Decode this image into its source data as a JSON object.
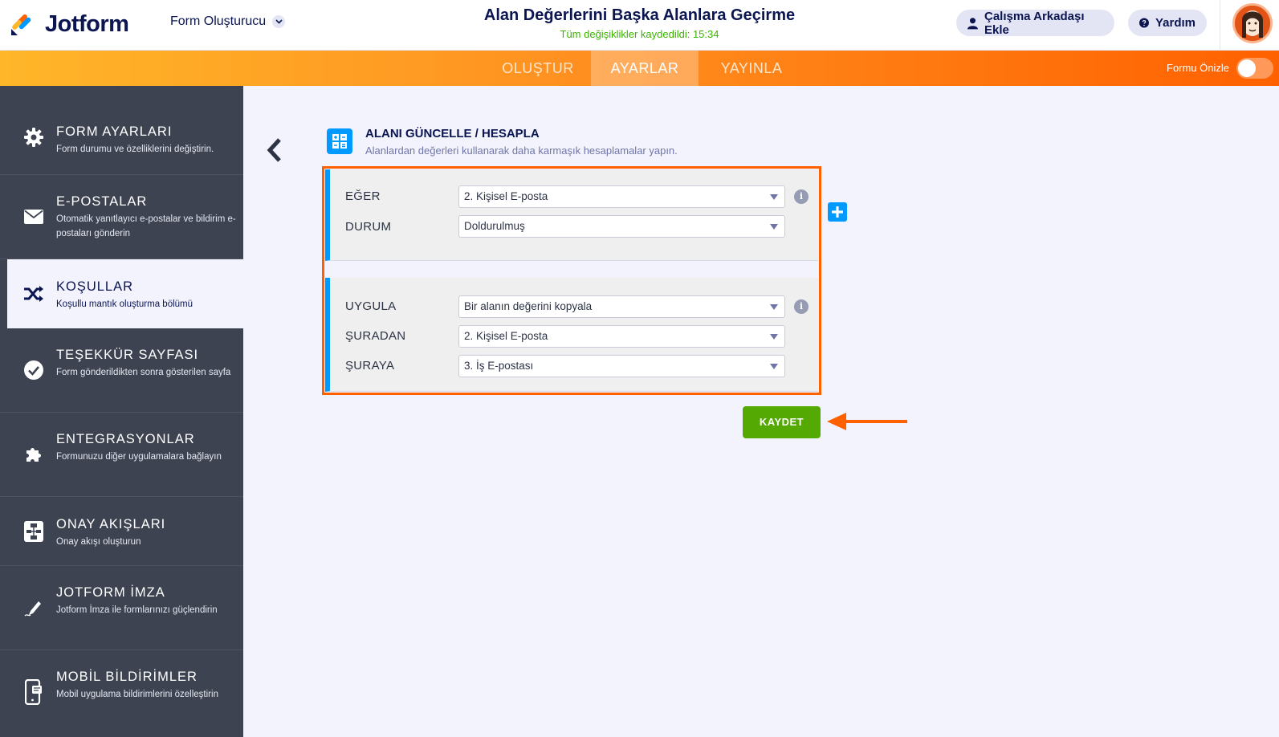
{
  "header": {
    "logo_text": "Jotform",
    "builder_select": "Form Oluşturucu",
    "title": "Alan Değerlerini Başka Alanlara Geçirme",
    "saved_status": "Tüm değişiklikler kaydedildi: 15:34",
    "invite_label": "Çalışma Arkadaşı Ekle",
    "help_label": "Yardım"
  },
  "tabs": {
    "create": "OLUŞTUR",
    "settings": "AYARLAR",
    "publish": "YAYINLA",
    "active": "AYARLAR"
  },
  "preview": {
    "label": "Formu Önizle",
    "enabled": false
  },
  "sidebar": {
    "items": [
      {
        "title": "FORM AYARLARI",
        "desc": "Form durumu ve özelliklerini değiştirin.",
        "icon": "gear-icon"
      },
      {
        "title": "E-POSTALAR",
        "desc": "Otomatik yanıtlayıcı e-postalar ve bildirim e-postaları gönderin",
        "icon": "envelope-icon"
      },
      {
        "title": "KOŞULLAR",
        "desc": "Koşullu mantık oluşturma bölümü",
        "icon": "shuffle-icon",
        "active": true
      },
      {
        "title": "TEŞEKKÜR SAYFASI",
        "desc": "Form gönderildikten sonra gösterilen sayfa",
        "icon": "check-circle-icon"
      },
      {
        "title": "ENTEGRASYONLAR",
        "desc": "Formunuzu diğer uygulamalara bağlayın",
        "icon": "puzzle-icon"
      },
      {
        "title": "ONAY AKIŞLARI",
        "desc": "Onay akışı oluşturun",
        "icon": "flow-icon"
      },
      {
        "title": "JOTFORM İMZA",
        "desc": "Jotform İmza ile formlarınızı güçlendirin",
        "icon": "pen-icon"
      },
      {
        "title": "MOBİL BİLDİRİMLER",
        "desc": "Mobil uygulama bildirimlerini özelleştirin",
        "icon": "mobile-icon"
      }
    ]
  },
  "section": {
    "title": "ALANI GÜNCELLE / HESAPLA",
    "subtitle": "Alanlardan değerleri kullanarak daha karmaşık hesaplamalar yapın."
  },
  "condition": {
    "if_label": "EĞER",
    "if_value": "2. Kişisel E-posta",
    "state_label": "DURUM",
    "state_value": "Doldurulmuş"
  },
  "action": {
    "do_label": "UYGULA",
    "do_value": "Bir alanın değerini kopyala",
    "from_label": "ŞURADAN",
    "from_value": "2. Kişisel E-posta",
    "to_label": "ŞURAYA",
    "to_value": "3. İş E-postası"
  },
  "save_label": "KAYDET",
  "info_glyph": "i",
  "colors": {
    "accent_orange": "#ff6100",
    "save_green": "#54a903",
    "condition_blue": "#0099ff",
    "sidebar_bg": "#3d4350"
  }
}
